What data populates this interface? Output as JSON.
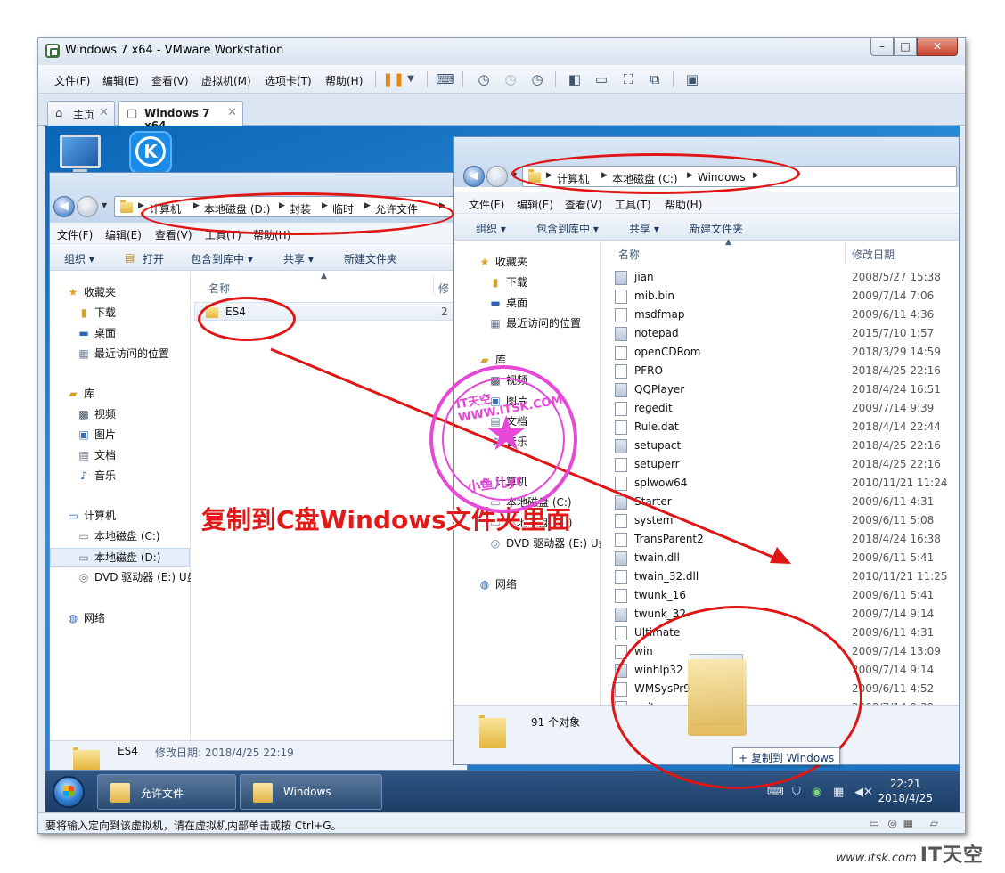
{
  "window": {
    "title": "Windows 7 x64 - VMware Workstation",
    "controls": {
      "minimize": "–",
      "maximize": "□",
      "close": "✕"
    }
  },
  "menu": [
    "文件(F)",
    "编辑(E)",
    "查看(V)",
    "虚拟机(M)",
    "选项卡(T)",
    "帮助(H)"
  ],
  "tabs": [
    {
      "label": "主页",
      "active": false
    },
    {
      "label": "Windows 7 x64",
      "active": true
    }
  ],
  "left_explorer": {
    "breadcrumbs": [
      "计算机",
      "本地磁盘 (D:)",
      "封装",
      "临时",
      "允许文件"
    ],
    "menu": [
      "文件(F)",
      "编辑(E)",
      "查看(V)",
      "工具(T)",
      "帮助(H)"
    ],
    "commands": [
      "组织 ▾",
      "打开",
      "包含到库中 ▾",
      "共享 ▾",
      "新建文件夹"
    ],
    "nav": {
      "favorites": "收藏夹",
      "fav_items": [
        "下载",
        "桌面",
        "最近访问的位置"
      ],
      "libraries": "库",
      "lib_items": [
        "视频",
        "图片",
        "文档",
        "音乐"
      ],
      "computer": "计算机",
      "comp_items": [
        "本地磁盘 (C:)",
        "本地磁盘 (D:)",
        "DVD 驱动器 (E:) U盘"
      ],
      "network": "网络"
    },
    "column_name": "名称",
    "column_partial": "修",
    "files": [
      {
        "name": "ES4",
        "date_partial": "2"
      }
    ],
    "status": {
      "name": "ES4",
      "detail": "修改日期: 2018/4/25 22:19"
    }
  },
  "right_explorer": {
    "breadcrumbs": [
      "计算机",
      "本地磁盘 (C:)",
      "Windows"
    ],
    "menu": [
      "文件(F)",
      "编辑(E)",
      "查看(V)",
      "工具(T)",
      "帮助(H)"
    ],
    "commands": [
      "组织 ▾",
      "包含到库中 ▾",
      "共享 ▾",
      "新建文件夹"
    ],
    "nav": {
      "favorites": "收藏夹",
      "fav_items": [
        "下载",
        "桌面",
        "最近访问的位置"
      ],
      "libraries": "库",
      "lib_items": [
        "视频",
        "图片",
        "文档",
        "音乐"
      ],
      "computer": "计算机",
      "comp_items": [
        "本地磁盘 (C:)",
        "本地磁盘 (D:)",
        "DVD 驱动器 (E:) U盘"
      ],
      "network": "网络"
    },
    "columns": {
      "name": "名称",
      "date": "修改日期"
    },
    "files": [
      {
        "name": "jian",
        "date": "2008/5/27 15:38"
      },
      {
        "name": "mib.bin",
        "date": "2009/7/14 7:06"
      },
      {
        "name": "msdfmap",
        "date": "2009/6/11 4:36"
      },
      {
        "name": "notepad",
        "date": "2015/7/10 1:57"
      },
      {
        "name": "openCDRom",
        "date": "2018/3/29 14:59"
      },
      {
        "name": "PFRO",
        "date": "2018/4/25 22:16"
      },
      {
        "name": "QQPlayer",
        "date": "2018/4/24 16:51"
      },
      {
        "name": "regedit",
        "date": "2009/7/14 9:39"
      },
      {
        "name": "Rule.dat",
        "date": "2018/4/14 22:44"
      },
      {
        "name": "setupact",
        "date": "2018/4/25 22:16"
      },
      {
        "name": "setuperr",
        "date": "2018/4/25 22:16"
      },
      {
        "name": "splwow64",
        "date": "2010/11/21 11:24"
      },
      {
        "name": "Starter",
        "date": "2009/6/11 4:31"
      },
      {
        "name": "system",
        "date": "2009/6/11 5:08"
      },
      {
        "name": "TransParent2",
        "date": "2018/4/24 16:38"
      },
      {
        "name": "twain.dll",
        "date": "2009/6/11 5:41"
      },
      {
        "name": "twain_32.dll",
        "date": "2010/11/21 11:25"
      },
      {
        "name": "twunk_16",
        "date": "2009/6/11 5:41"
      },
      {
        "name": "twunk_32",
        "date": "2009/7/14 9:14"
      },
      {
        "name": "Ultimate",
        "date": "2009/6/11 4:31"
      },
      {
        "name": "win",
        "date": "2009/7/14 13:09"
      },
      {
        "name": "winhlp32",
        "date": "2009/7/14 9:14"
      },
      {
        "name": "WMSysPr9.prx",
        "date": "2009/6/11 4:52"
      },
      {
        "name": "write",
        "date": "2009/7/14 9:39"
      }
    ],
    "status_count": "91 个对象"
  },
  "drag_tooltip": "+ 复制到 Windows",
  "annotation": "复制到C盘Windows文件夹里面",
  "stamp": {
    "top": "IT天空WWW.ITSK.COM",
    "bottom": "小鱼儿yr"
  },
  "taskbar": {
    "buttons": [
      "允许文件",
      "Windows"
    ],
    "time": "22:21",
    "date": "2018/4/25"
  },
  "vm_status": "要将输入定向到该虚拟机，请在虚拟机内部单击或按 Ctrl+G。",
  "watermark": {
    "url": "www.itsk.com",
    "brand": "IT天空"
  },
  "colors": {
    "annotation": "#e01616",
    "stamp": "#e648d8"
  }
}
